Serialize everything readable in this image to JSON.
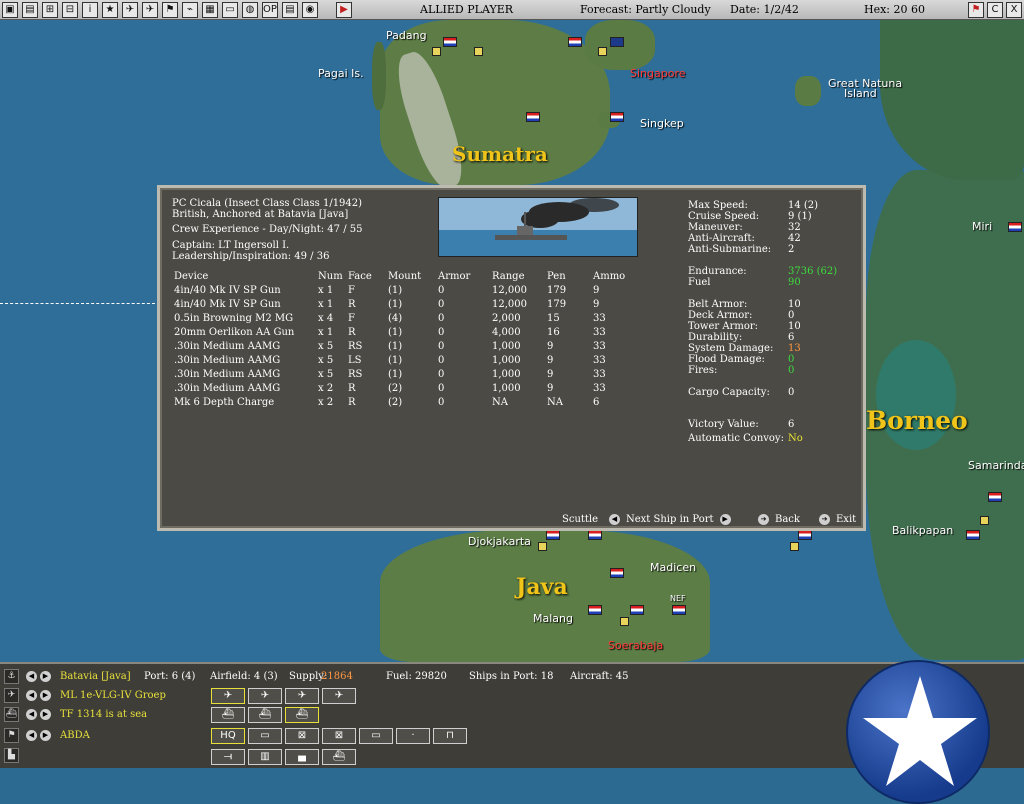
{
  "topbar": {
    "icons": [
      "▣",
      "▤",
      "⊞",
      "⊟",
      "i",
      "★",
      "✈",
      "✈",
      "⚑",
      "⌁",
      "▦",
      "▭",
      "◍",
      "OP",
      "▤",
      "◉"
    ],
    "play_icon": "▶",
    "player": "ALLIED PLAYER",
    "forecast": "Forecast: Partly Cloudy",
    "date": "Date: 1/2/42",
    "hex": "Hex: 20 60",
    "right_icons": [
      "⚑",
      "C",
      "X"
    ]
  },
  "map": {
    "labels": {
      "padang": "Padang",
      "pagai": "Pagai Is.",
      "singapore": "Singapore",
      "singkep": "Singkep",
      "natuna1": "Great Natuna",
      "natuna2": "Island",
      "miri": "Miri",
      "samarinda": "Samarinda",
      "balikpapan": "Balikpapan",
      "djokjakarta": "Djokjakarta",
      "madicen": "Madicen",
      "malang": "Malang",
      "soerabaja": "Soerabaja",
      "nef": "NEF"
    },
    "regions": {
      "sumatra": "Sumatra",
      "borneo": "Borneo",
      "java": "Java"
    }
  },
  "dialog": {
    "ship_name": "PC Cicala (Insect Class Class 1/1942)",
    "status": "British, Anchored at Batavia [Java]",
    "crew_exp": "Crew Experience - Day/Night: 47 / 55",
    "captain": "Captain:  LT Ingersoll I.",
    "leadership": "Leadership/Inspiration: 49 / 36",
    "columns": [
      "Device",
      "Num",
      "Face",
      "Mount",
      "Armor",
      "Range",
      "Pen",
      "Ammo"
    ],
    "devices": [
      [
        "4in/40 Mk IV SP Gun",
        "x 1",
        "F",
        "(1)",
        "0",
        "12,000",
        "179",
        "9"
      ],
      [
        "4in/40 Mk IV SP Gun",
        "x 1",
        "R",
        "(1)",
        "0",
        "12,000",
        "179",
        "9"
      ],
      [
        "0.5in Browning M2 MG",
        "x 4",
        "F",
        "(4)",
        "0",
        "2,000",
        "15",
        "33"
      ],
      [
        "20mm Oerlikon AA Gun",
        "x 1",
        "R",
        "(1)",
        "0",
        "4,000",
        "16",
        "33"
      ],
      [
        ".30in Medium AAMG",
        "x 5",
        "RS",
        "(1)",
        "0",
        "1,000",
        "9",
        "33"
      ],
      [
        ".30in Medium AAMG",
        "x 5",
        "LS",
        "(1)",
        "0",
        "1,000",
        "9",
        "33"
      ],
      [
        ".30in Medium AAMG",
        "x 5",
        "RS",
        "(1)",
        "0",
        "1,000",
        "9",
        "33"
      ],
      [
        ".30in Medium AAMG",
        "x 2",
        "R",
        "(2)",
        "0",
        "1,000",
        "9",
        "33"
      ],
      [
        "Mk 6 Depth Charge",
        "x 2",
        "R",
        "(2)",
        "0",
        "NA",
        "NA",
        "6"
      ]
    ],
    "stats": {
      "max_speed_l": "Max Speed:",
      "max_speed": "14 (2)",
      "cruise_speed_l": "Cruise Speed:",
      "cruise_speed": "9 (1)",
      "maneuver_l": "Maneuver:",
      "maneuver": "32",
      "anti_aircraft_l": "Anti-Aircraft:",
      "anti_aircraft": "42",
      "anti_sub_l": "Anti-Submarine:",
      "anti_sub": "2",
      "endurance_l": "Endurance:",
      "endurance": "3736 (62)",
      "fuel_l": "Fuel",
      "fuel": "90",
      "belt_armor_l": "Belt Armor:",
      "belt_armor": "10",
      "deck_armor_l": "Deck Armor:",
      "deck_armor": "0",
      "tower_armor_l": "Tower Armor:",
      "tower_armor": "10",
      "durability_l": "Durability:",
      "durability": "6",
      "sys_damage_l": "System Damage:",
      "sys_damage": "13",
      "flood_damage_l": "Flood Damage:",
      "flood_damage": "0",
      "fires_l": "Fires:",
      "fires": "0",
      "cargo_l": "Cargo Capacity:",
      "cargo": "0",
      "victory_l": "Victory Value:",
      "victory": "6",
      "convoy_l": "Automatic Convoy:",
      "convoy": "No"
    },
    "buttons": {
      "scuttle": "Scuttle",
      "next_ship": "Next Ship in Port",
      "back": "Back",
      "exit": "Exit",
      "left_arrow": "◀",
      "right_arrow": "▶",
      "go_arrow": "➔"
    }
  },
  "bottom": {
    "rows": [
      {
        "icon": "⚓",
        "label": "Batavia [Java]"
      },
      {
        "icon": "✈",
        "label": "ML 1e-VLG-IV Groep"
      },
      {
        "icon": "⛴",
        "label": "TF 1314 is at sea"
      },
      {
        "icon": "⚑",
        "label": "ABDA"
      },
      {
        "icon": "▙",
        "label": ""
      }
    ],
    "nav_prev": "◀",
    "nav_next": "▶",
    "port": "Port: 6 (4)",
    "airfield": "Airfield: 4 (3)",
    "supply_l": "Supply:",
    "supply": "21864",
    "fuel": "Fuel: 29820",
    "ships_in_port": "Ships in Port: 18",
    "aircraft": "Aircraft: 45",
    "air_buttons": [
      "✈",
      "✈",
      "✈",
      "✈"
    ],
    "ship_buttons": [
      "⛴",
      "⛴",
      "⛴"
    ],
    "hq_buttons": [
      "HQ",
      "▭",
      "⊠",
      "⊠",
      "▭",
      "·",
      "⊓"
    ],
    "ground_buttons": [
      "⟞",
      "▥",
      "▄",
      "⛴"
    ]
  },
  "colors": {
    "dialog_bg": "#4b4a45",
    "green": "#3ddc3d",
    "orange": "#ff9640",
    "yellow": "#e9e232",
    "region_label": "#f0c419",
    "star_blue": "#163b8c"
  }
}
